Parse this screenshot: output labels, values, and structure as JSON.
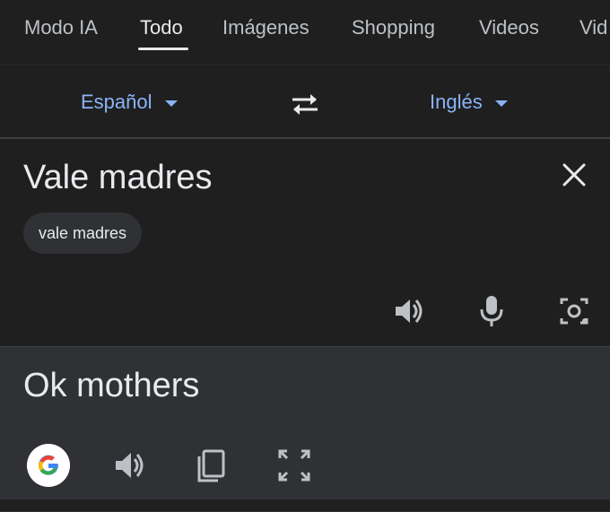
{
  "tabs": [
    {
      "label": "Modo IA",
      "active": false
    },
    {
      "label": "Todo",
      "active": true
    },
    {
      "label": "Imágenes",
      "active": false
    },
    {
      "label": "Shopping",
      "active": false
    },
    {
      "label": "Videos",
      "active": false
    },
    {
      "label": "Vid",
      "active": false
    }
  ],
  "translator": {
    "source_language": "Español",
    "target_language": "Inglés",
    "source_text": "Vale madres",
    "suggestion_chip": "vale madres",
    "translated_text": "Ok mothers"
  },
  "icons": {
    "swap": "swap-languages-icon",
    "clear": "close-icon",
    "listen_source": "speaker-icon",
    "voice_input": "microphone-icon",
    "camera_input": "camera-icon",
    "google": "google-logo",
    "listen_target": "speaker-icon",
    "copy": "copy-icon",
    "fullscreen": "fullscreen-icon"
  },
  "colors": {
    "background": "#1f1f1f",
    "result_panel": "#303134",
    "accent": "#8ab4f8",
    "text": "#e8eaed",
    "icon": "#bdc1c6"
  }
}
